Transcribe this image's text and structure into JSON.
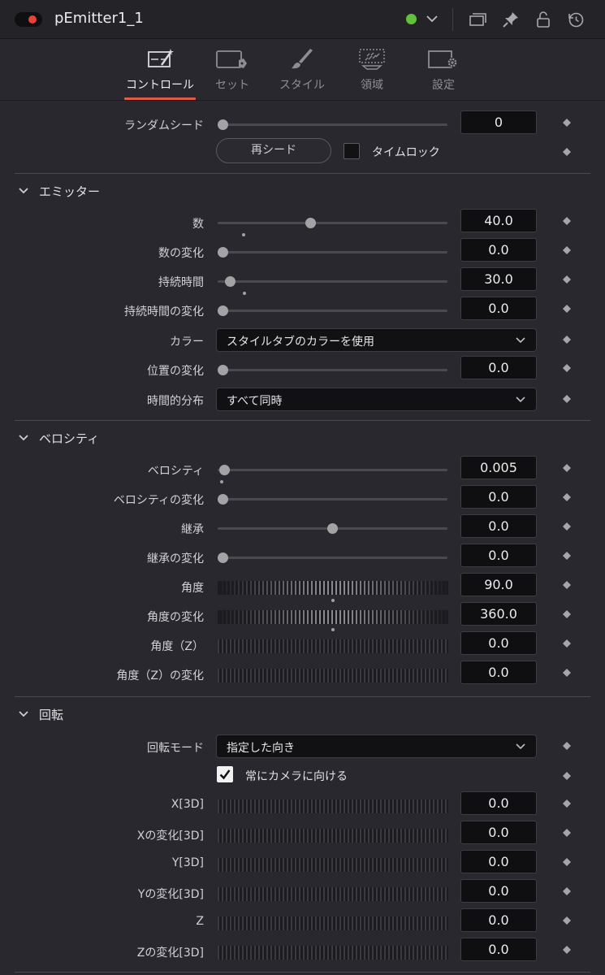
{
  "header": {
    "node_name": "pEmitter1_1",
    "status_color": "#62c13b",
    "icons": [
      "window-icon",
      "pin-icon",
      "lock-icon",
      "reset-icon"
    ]
  },
  "tabs": [
    {
      "label": "コントロール",
      "icon": "controls-icon",
      "active": true
    },
    {
      "label": "セット",
      "icon": "set-icon",
      "active": false
    },
    {
      "label": "スタイル",
      "icon": "brush-icon",
      "active": false
    },
    {
      "label": "領域",
      "icon": "region-icon",
      "active": false
    },
    {
      "label": "設定",
      "icon": "settings-icon",
      "active": false
    }
  ],
  "top": {
    "random_seed": {
      "label": "ランダムシード",
      "value": "0"
    },
    "reseed_button": "再シード",
    "time_lock": {
      "label": "タイムロック",
      "checked": false
    }
  },
  "sections": {
    "emitter": {
      "title": "エミッター",
      "number": {
        "label": "数",
        "value": "40.0"
      },
      "number_variance": {
        "label": "数の変化",
        "value": "0.0"
      },
      "lifespan": {
        "label": "持続時間",
        "value": "30.0"
      },
      "lifespan_variance": {
        "label": "持続時間の変化",
        "value": "0.0"
      },
      "color": {
        "label": "カラー",
        "selected": "スタイルタブのカラーを使用"
      },
      "position_variance": {
        "label": "位置の変化",
        "value": "0.0"
      },
      "temporal_distribution": {
        "label": "時間的分布",
        "selected": "すべて同時"
      }
    },
    "velocity": {
      "title": "ベロシティ",
      "velocity": {
        "label": "ベロシティ",
        "value": "0.005"
      },
      "velocity_variance": {
        "label": "ベロシティの変化",
        "value": "0.0"
      },
      "inherit": {
        "label": "継承",
        "value": "0.0"
      },
      "inherit_variance": {
        "label": "継承の変化",
        "value": "0.0"
      },
      "angle": {
        "label": "角度",
        "value": "90.0"
      },
      "angle_variance": {
        "label": "角度の変化",
        "value": "360.0"
      },
      "angle_z": {
        "label": "角度（Z）",
        "value": "0.0"
      },
      "angle_z_variance": {
        "label": "角度（Z）の変化",
        "value": "0.0"
      }
    },
    "rotation": {
      "title": "回転",
      "rotation_mode": {
        "label": "回転モード",
        "selected": "指定した向き"
      },
      "always_face_camera": {
        "label": "常にカメラに向ける",
        "checked": true
      },
      "x": {
        "label": "X[3D]",
        "value": "0.0"
      },
      "x_variance": {
        "label": "Xの変化[3D]",
        "value": "0.0"
      },
      "y": {
        "label": "Y[3D]",
        "value": "0.0"
      },
      "y_variance": {
        "label": "Yの変化[3D]",
        "value": "0.0"
      },
      "z": {
        "label": "Z",
        "value": "0.0"
      },
      "z_variance": {
        "label": "Zの変化[3D]",
        "value": "0.0"
      }
    }
  }
}
